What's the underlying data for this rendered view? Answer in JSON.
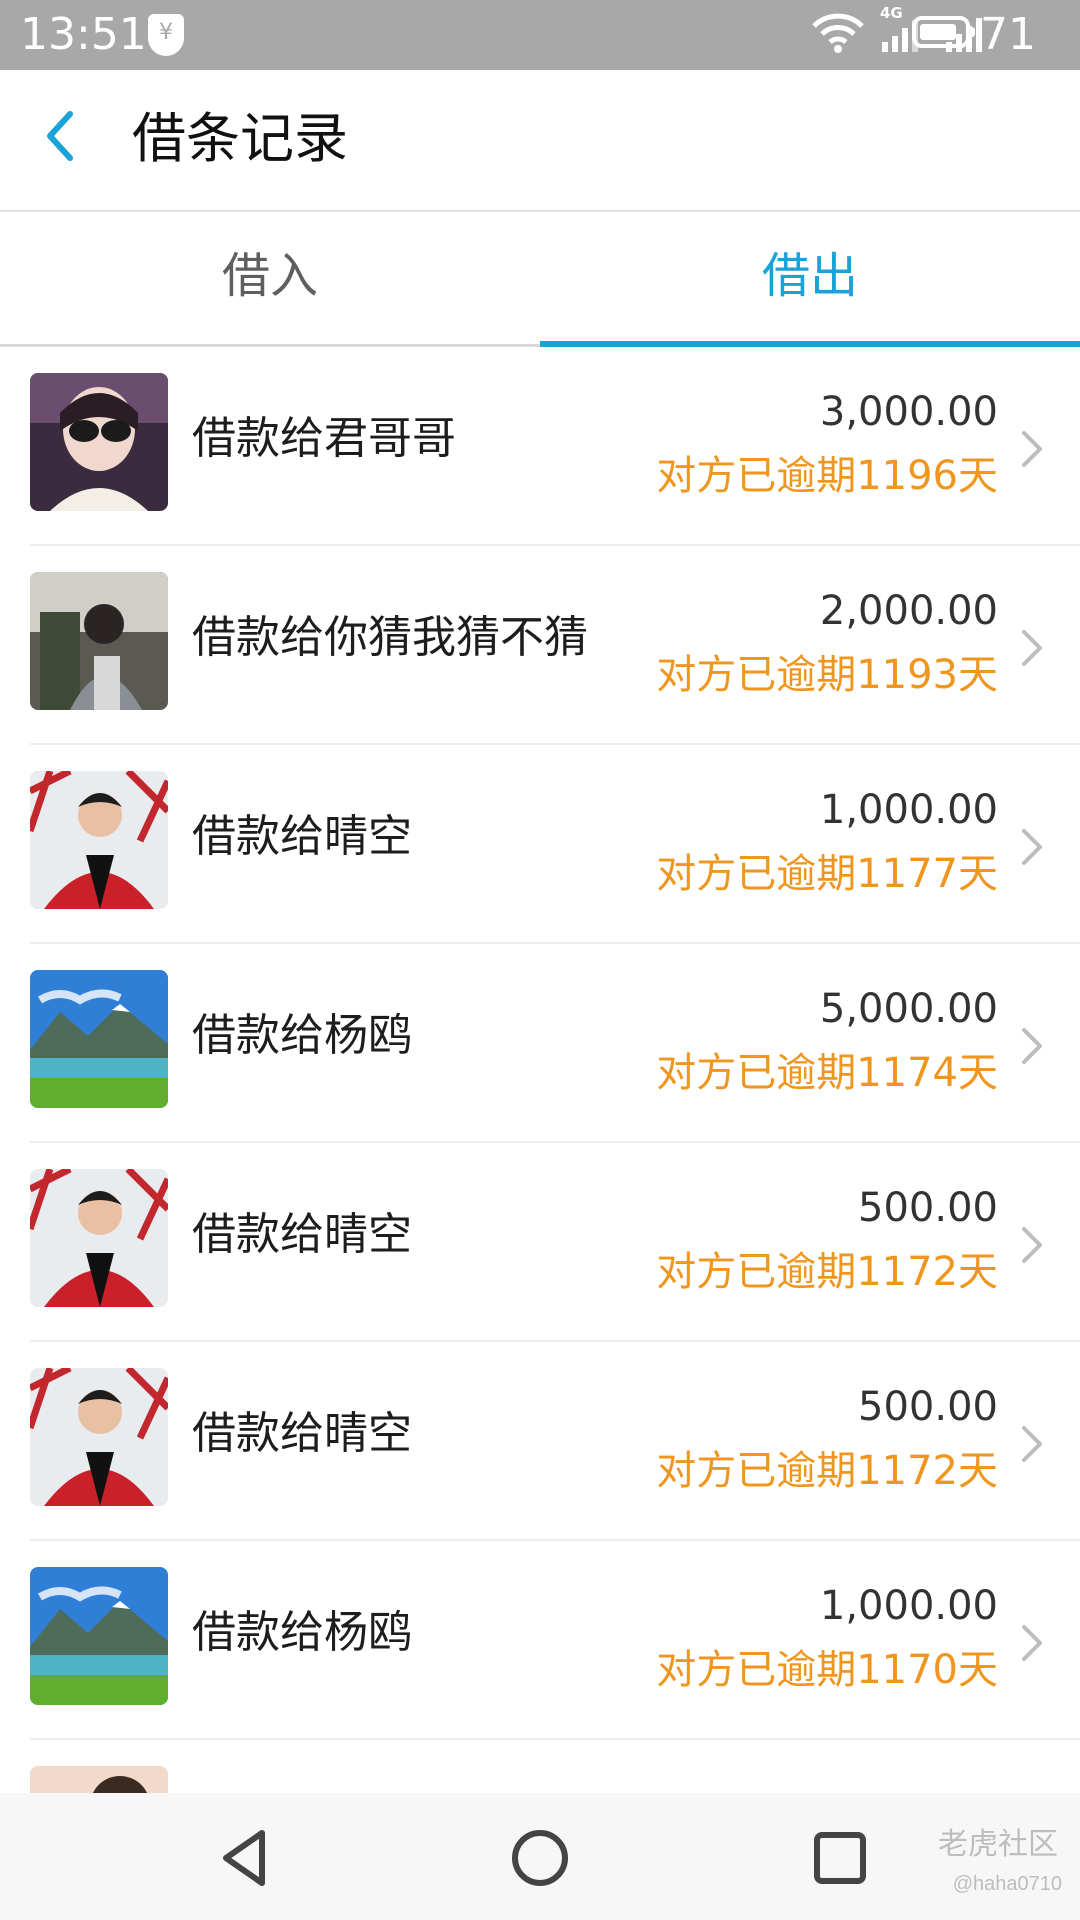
{
  "status_bar": {
    "time": "13:51",
    "shield_glyph": "¥",
    "network_label": "4G",
    "battery_level": "71"
  },
  "header": {
    "title": "借条记录"
  },
  "tabs": [
    {
      "label": "借入",
      "active": false
    },
    {
      "label": "借出",
      "active": true
    }
  ],
  "colors": {
    "accent": "#1aa3d9",
    "overdue": "#f0961f",
    "status_bar": "#a8a8a8"
  },
  "loans": [
    {
      "name": "借款给君哥哥",
      "amount": "3,000.00",
      "status": "对方已逾期1196天",
      "avatar": "avatar-woman-sunglasses"
    },
    {
      "name": "借款给你猜我猜不猜",
      "amount": "2,000.00",
      "status": "对方已逾期1193天",
      "avatar": "avatar-girl-outdoor"
    },
    {
      "name": "借款给晴空",
      "amount": "1,000.00",
      "status": "对方已逾期1177天",
      "avatar": "avatar-man-red-jacket"
    },
    {
      "name": "借款给杨鸥",
      "amount": "5,000.00",
      "status": "对方已逾期1174天",
      "avatar": "avatar-mountain-lake"
    },
    {
      "name": "借款给晴空",
      "amount": "500.00",
      "status": "对方已逾期1172天",
      "avatar": "avatar-man-red-jacket"
    },
    {
      "name": "借款给晴空",
      "amount": "500.00",
      "status": "对方已逾期1172天",
      "avatar": "avatar-man-red-jacket"
    },
    {
      "name": "借款给杨鸥",
      "amount": "1,000.00",
      "status": "对方已逾期1170天",
      "avatar": "avatar-mountain-lake"
    },
    {
      "name": "",
      "amount": "",
      "status": "",
      "avatar": "avatar-partial"
    }
  ],
  "nav": {
    "back_icon": "triangle-back-icon",
    "home_icon": "circle-home-icon",
    "recents_icon": "square-recents-icon"
  },
  "watermark": {
    "text": "老虎社区",
    "user": "@haha0710"
  }
}
